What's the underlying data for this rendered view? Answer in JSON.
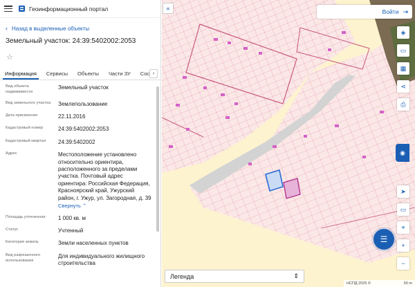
{
  "header": {
    "app_title": "Геоинформационный портал"
  },
  "panel": {
    "back_label": "Назад в выделенные объекты",
    "parcel_title": "Земельный участок: 24:39:5402002:2053",
    "tabs": [
      {
        "label": "Информация",
        "active": true
      },
      {
        "label": "Сервисы",
        "active": false
      },
      {
        "label": "Объекты",
        "active": false
      },
      {
        "label": "Части ЗУ",
        "active": false
      },
      {
        "label": "Состав",
        "active": false
      }
    ],
    "properties": [
      {
        "key": "Вид объекта недвижимости",
        "value": "Земельный участок"
      },
      {
        "key": "Вид земельного участка",
        "value": "Землепользование"
      },
      {
        "key": "Дата присвоения",
        "value": "22.11.2016"
      },
      {
        "key": "Кадастровый номер",
        "value": "24:39:5402002:2053"
      },
      {
        "key": "Кадастровый квартал",
        "value": "24:39:5402002"
      },
      {
        "key": "Адрес",
        "value": "Местоположение установлено относительно ориентира, расположенного за пределами участка. Почтовый адрес ориентира: Российская Федерация, Красноярский край, Ужурский район, г. Ужур, ул. Загородная, д. 39"
      },
      {
        "key": "Площадь уточненная",
        "value": "1 000 кв. м"
      },
      {
        "key": "Статус",
        "value": "Учтенный"
      },
      {
        "key": "Категория земель",
        "value": "Земли населенных пунктов"
      },
      {
        "key": "Вид разрешенного использования",
        "value": "Для индивидуального жилищного строительства"
      }
    ],
    "expand_label": "Свернуть"
  },
  "map": {
    "login_label": "Войти",
    "legend_label": "Легенда",
    "attribution": "НСПД 2025 ©",
    "scale_label": "50 m"
  },
  "icons": {
    "menu": "menu-icon",
    "back": "chevron-left-icon",
    "star": "star-icon",
    "login": "login-icon",
    "layers": "layers-icon",
    "basemap": "basemap-icon",
    "measure": "measure-icon",
    "share": "share-icon",
    "print": "print-icon",
    "locate": "locate-icon",
    "zoom_in": "plus-icon",
    "zoom_out": "minus-icon",
    "chat": "chat-icon"
  },
  "colors": {
    "accent": "#1a5fb4",
    "parcel_selected": "#2b6cd6",
    "parcel_highlight": "#b0338f",
    "building": "#d462c7",
    "map_bg": "#fdf3cf",
    "grid": "#e6a6bb"
  }
}
